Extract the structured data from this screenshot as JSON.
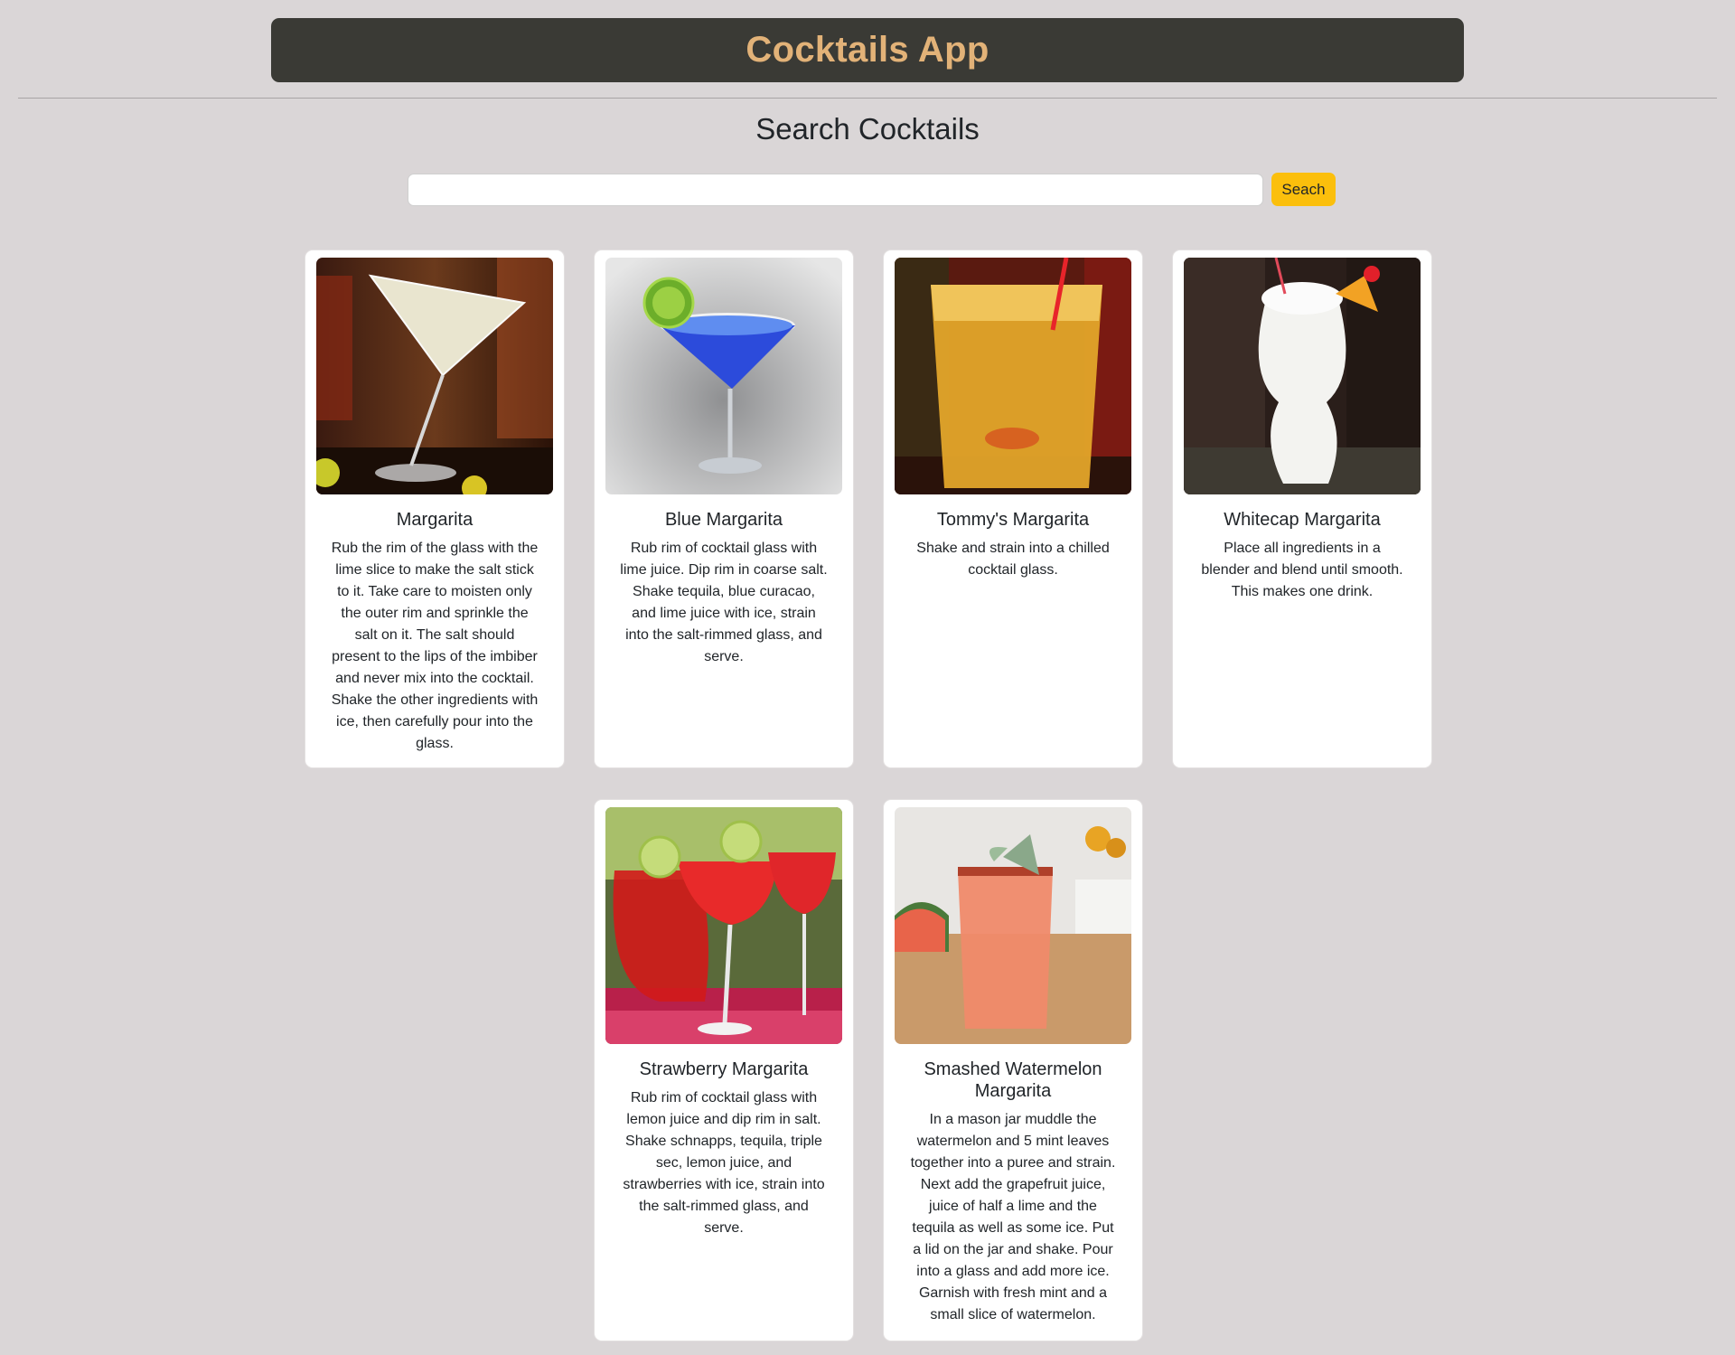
{
  "header": {
    "title": "Cocktails App"
  },
  "search": {
    "heading": "Search Cocktails",
    "value": "",
    "placeholder": "",
    "button_label": "Seach"
  },
  "colors": {
    "header_bg": "#3a3a35",
    "header_text": "#e2b278",
    "page_bg": "#dad6d7",
    "button": "#fbbf0c"
  },
  "cocktails": [
    {
      "name": "Margarita",
      "image_icon": "martini-glass-image",
      "instructions": "Rub the rim of the glass with the lime slice to make the salt stick to it. Take care to moisten only the outer rim and sprinkle the salt on it. The salt should present to the lips of the imbiber and never mix into the cocktail. Shake the other ingredients with ice, then carefully pour into the glass."
    },
    {
      "name": "Blue Margarita",
      "image_icon": "blue-margarita-image",
      "instructions": "Rub rim of cocktail glass with lime juice. Dip rim in coarse salt. Shake tequila, blue curacao, and lime juice with ice, strain into the salt-rimmed glass, and serve."
    },
    {
      "name": "Tommy's Margarita",
      "image_icon": "rocks-glass-image",
      "instructions": "Shake and strain into a chilled cocktail glass."
    },
    {
      "name": "Whitecap Margarita",
      "image_icon": "hurricane-glass-image",
      "instructions": "Place all ingredients in a blender and blend until smooth. This makes one drink."
    },
    {
      "name": "Strawberry Margarita",
      "image_icon": "strawberry-margarita-image",
      "instructions": "Rub rim of cocktail glass with lemon juice and dip rim in salt. Shake schnapps, tequila, triple sec, lemon juice, and strawberries with ice, strain into the salt-rimmed glass, and serve."
    },
    {
      "name": "Smashed Watermelon Margarita",
      "image_icon": "watermelon-margarita-image",
      "instructions": "In a mason jar muddle the watermelon and 5 mint leaves together into a puree and strain. Next add the grapefruit juice, juice of half a lime and the tequila as well as some ice. Put a lid on the jar and shake. Pour into a glass and add more ice. Garnish with fresh mint and a small slice of watermelon."
    }
  ]
}
